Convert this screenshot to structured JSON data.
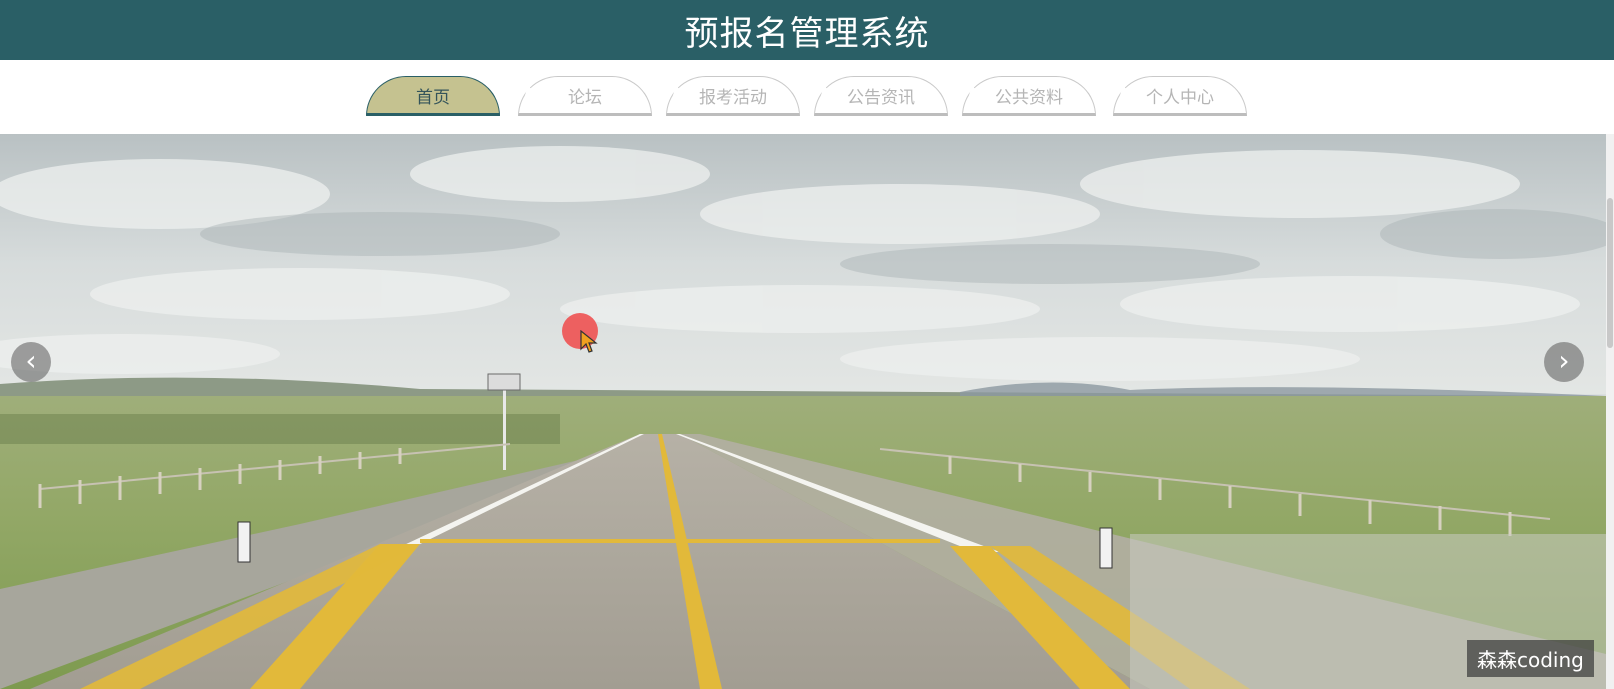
{
  "header": {
    "title": "预报名管理系统",
    "background_color": "#2a5f66"
  },
  "nav": {
    "items": [
      {
        "label": "首页",
        "active": true
      },
      {
        "label": "论坛",
        "active": false
      },
      {
        "label": "报考活动",
        "active": false
      },
      {
        "label": "公告资讯",
        "active": false
      },
      {
        "label": "公共资料",
        "active": false
      },
      {
        "label": "个人中心",
        "active": false
      }
    ],
    "active_color": "#c5c290"
  },
  "carousel": {
    "image_description_icon": "landscape-photo",
    "prev_icon": "chevron-left-icon",
    "next_icon": "chevron-right-icon",
    "prev_glyph": "‹",
    "next_glyph": "›"
  },
  "watermark": {
    "text": "森森coding"
  }
}
